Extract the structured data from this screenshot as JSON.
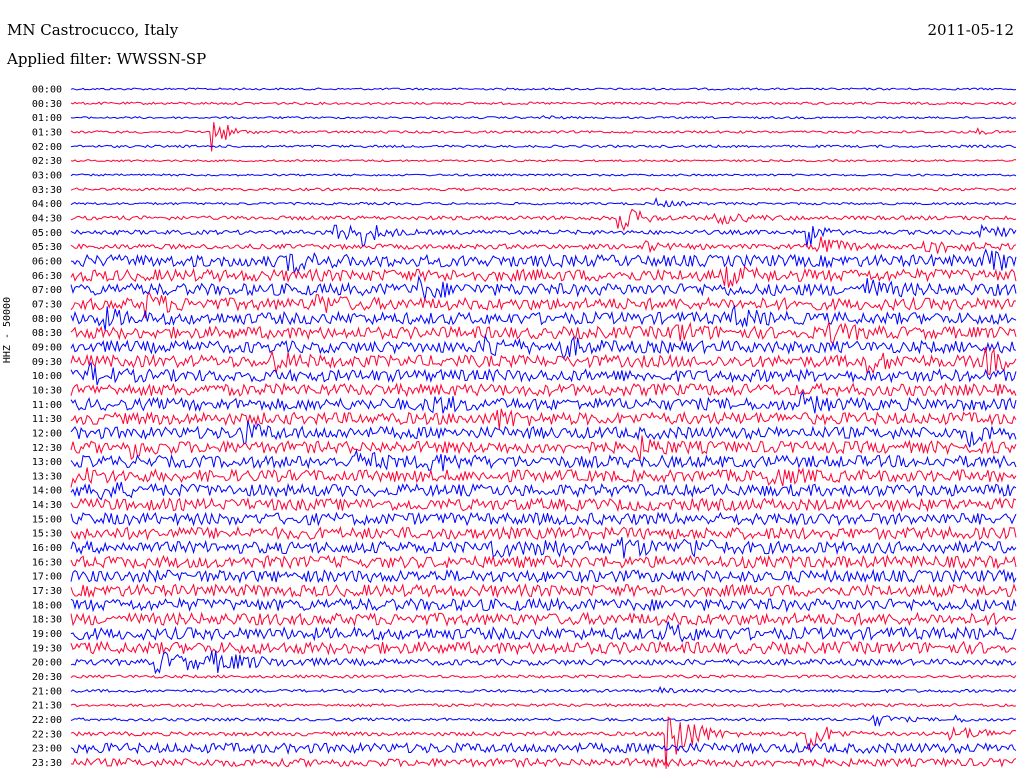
{
  "header": {
    "station": "MN Castrocucco, Italy",
    "date": "2011-05-12",
    "filter": "Applied filter: WWSSN-SP"
  },
  "chart_data": {
    "type": "helicorder",
    "ylabel": "HHZ - 50000",
    "colors": [
      "#0000ff",
      "#ff0033"
    ],
    "rows": [
      {
        "label": "00:00",
        "noise": 1.0,
        "events": []
      },
      {
        "label": "00:30",
        "noise": 1.2,
        "events": []
      },
      {
        "label": "01:00",
        "noise": 1.0,
        "events": [
          {
            "t": 0.5,
            "a": 3,
            "d": 0.01
          }
        ]
      },
      {
        "label": "01:30",
        "noise": 1.2,
        "events": [
          {
            "t": 0.15,
            "a": 22,
            "d": 0.012
          },
          {
            "t": 0.96,
            "a": 3,
            "d": 0.008
          }
        ]
      },
      {
        "label": "02:00",
        "noise": 1.2,
        "events": []
      },
      {
        "label": "02:30",
        "noise": 1.0,
        "events": []
      },
      {
        "label": "03:00",
        "noise": 1.0,
        "events": []
      },
      {
        "label": "03:30",
        "noise": 1.4,
        "events": []
      },
      {
        "label": "04:00",
        "noise": 1.2,
        "events": [
          {
            "t": 0.62,
            "a": 4,
            "d": 0.02
          }
        ]
      },
      {
        "label": "04:30",
        "noise": 2.0,
        "events": [
          {
            "t": 0.58,
            "a": 14,
            "d": 0.02
          },
          {
            "t": 0.68,
            "a": 6,
            "d": 0.03
          }
        ]
      },
      {
        "label": "05:00",
        "noise": 2.2,
        "events": [
          {
            "t": 0.28,
            "a": 9,
            "d": 0.025
          },
          {
            "t": 0.31,
            "a": 10,
            "d": 0.015
          },
          {
            "t": 0.78,
            "a": 18,
            "d": 0.01
          },
          {
            "t": 0.96,
            "a": 6,
            "d": 0.03
          }
        ]
      },
      {
        "label": "05:30",
        "noise": 2.5,
        "events": [
          {
            "t": 0.6,
            "a": 6,
            "d": 0.02
          },
          {
            "t": 0.79,
            "a": 12,
            "d": 0.02
          },
          {
            "t": 0.9,
            "a": 7,
            "d": 0.04
          }
        ]
      },
      {
        "label": "06:00",
        "noise": 6,
        "events": [
          {
            "t": 0.23,
            "a": 10,
            "d": 0.02
          },
          {
            "t": 0.97,
            "a": 9,
            "d": 0.02
          }
        ]
      },
      {
        "label": "06:30",
        "noise": 6,
        "events": [
          {
            "t": 0.69,
            "a": 9,
            "d": 0.02
          }
        ]
      },
      {
        "label": "07:00",
        "noise": 6,
        "events": [
          {
            "t": 0.37,
            "a": 8,
            "d": 0.02
          },
          {
            "t": 0.84,
            "a": 8,
            "d": 0.02
          }
        ]
      },
      {
        "label": "07:30",
        "noise": 6,
        "events": [
          {
            "t": 0.08,
            "a": 9,
            "d": 0.02
          },
          {
            "t": 0.26,
            "a": 8,
            "d": 0.02
          }
        ]
      },
      {
        "label": "08:00",
        "noise": 6,
        "events": [
          {
            "t": 0.03,
            "a": 9,
            "d": 0.02
          },
          {
            "t": 0.7,
            "a": 8,
            "d": 0.02
          }
        ]
      },
      {
        "label": "08:30",
        "noise": 6,
        "events": [
          {
            "t": 0.64,
            "a": 8,
            "d": 0.02
          },
          {
            "t": 0.8,
            "a": 8,
            "d": 0.02
          }
        ]
      },
      {
        "label": "09:00",
        "noise": 6,
        "events": [
          {
            "t": 0.44,
            "a": 9,
            "d": 0.02
          },
          {
            "t": 0.52,
            "a": 8,
            "d": 0.02
          }
        ]
      },
      {
        "label": "09:30",
        "noise": 6,
        "events": [
          {
            "t": 0.21,
            "a": 9,
            "d": 0.02
          },
          {
            "t": 0.84,
            "a": 10,
            "d": 0.02
          },
          {
            "t": 0.97,
            "a": 9,
            "d": 0.02
          }
        ]
      },
      {
        "label": "10:00",
        "noise": 6,
        "events": [
          {
            "t": 0.02,
            "a": 8,
            "d": 0.02
          }
        ]
      },
      {
        "label": "10:30",
        "noise": 6,
        "events": []
      },
      {
        "label": "11:00",
        "noise": 6,
        "events": [
          {
            "t": 0.38,
            "a": 8,
            "d": 0.02
          },
          {
            "t": 0.77,
            "a": 8,
            "d": 0.02
          }
        ]
      },
      {
        "label": "11:30",
        "noise": 6,
        "events": [
          {
            "t": 0.45,
            "a": 8,
            "d": 0.02
          }
        ]
      },
      {
        "label": "12:00",
        "noise": 6,
        "events": [
          {
            "t": 0.18,
            "a": 9,
            "d": 0.02
          },
          {
            "t": 0.95,
            "a": 9,
            "d": 0.02
          }
        ]
      },
      {
        "label": "12:30",
        "noise": 6,
        "events": [
          {
            "t": 0.06,
            "a": 8,
            "d": 0.02
          },
          {
            "t": 0.6,
            "a": 8,
            "d": 0.02
          }
        ]
      },
      {
        "label": "13:00",
        "noise": 6,
        "events": [
          {
            "t": 0.3,
            "a": 9,
            "d": 0.02
          },
          {
            "t": 0.38,
            "a": 8,
            "d": 0.02
          }
        ]
      },
      {
        "label": "13:30",
        "noise": 6,
        "events": [
          {
            "t": 0.0,
            "a": 8,
            "d": 0.02
          },
          {
            "t": 0.74,
            "a": 8,
            "d": 0.02
          }
        ]
      },
      {
        "label": "14:00",
        "noise": 6,
        "events": [
          {
            "t": 0.03,
            "a": 8,
            "d": 0.02
          }
        ]
      },
      {
        "label": "14:30",
        "noise": 6,
        "events": []
      },
      {
        "label": "15:00",
        "noise": 6,
        "events": []
      },
      {
        "label": "15:30",
        "noise": 6,
        "events": []
      },
      {
        "label": "16:00",
        "noise": 6,
        "events": [
          {
            "t": 0.44,
            "a": 9,
            "d": 0.02
          },
          {
            "t": 0.49,
            "a": 9,
            "d": 0.02
          },
          {
            "t": 0.58,
            "a": 9,
            "d": 0.02
          },
          {
            "t": 0.65,
            "a": 8,
            "d": 0.02
          }
        ]
      },
      {
        "label": "16:30",
        "noise": 6,
        "events": []
      },
      {
        "label": "17:00",
        "noise": 6,
        "events": []
      },
      {
        "label": "17:30",
        "noise": 6,
        "events": []
      },
      {
        "label": "18:00",
        "noise": 6,
        "events": []
      },
      {
        "label": "18:30",
        "noise": 6,
        "events": []
      },
      {
        "label": "19:00",
        "noise": 6,
        "events": [
          {
            "t": 0.63,
            "a": 8,
            "d": 0.02
          }
        ]
      },
      {
        "label": "19:30",
        "noise": 6,
        "events": []
      },
      {
        "label": "20:00",
        "noise": 3,
        "events": [
          {
            "t": 0.09,
            "a": 9,
            "d": 0.06
          },
          {
            "t": 0.15,
            "a": 6,
            "d": 0.04
          }
        ]
      },
      {
        "label": "20:30",
        "noise": 1.5,
        "events": []
      },
      {
        "label": "21:00",
        "noise": 1.5,
        "events": [
          {
            "t": 0.62,
            "a": 4,
            "d": 0.01
          }
        ]
      },
      {
        "label": "21:30",
        "noise": 1.5,
        "events": []
      },
      {
        "label": "22:00",
        "noise": 1.5,
        "events": [
          {
            "t": 0.85,
            "a": 6,
            "d": 0.02
          },
          {
            "t": 0.93,
            "a": 5,
            "d": 0.01
          }
        ]
      },
      {
        "label": "22:30",
        "noise": 2.0,
        "events": [
          {
            "t": 0.63,
            "a": 48,
            "d": 0.02
          },
          {
            "t": 0.78,
            "a": 22,
            "d": 0.015
          },
          {
            "t": 0.93,
            "a": 6,
            "d": 0.05
          }
        ]
      },
      {
        "label": "23:00",
        "noise": 5,
        "events": []
      },
      {
        "label": "23:30",
        "noise": 4,
        "events": []
      }
    ]
  }
}
